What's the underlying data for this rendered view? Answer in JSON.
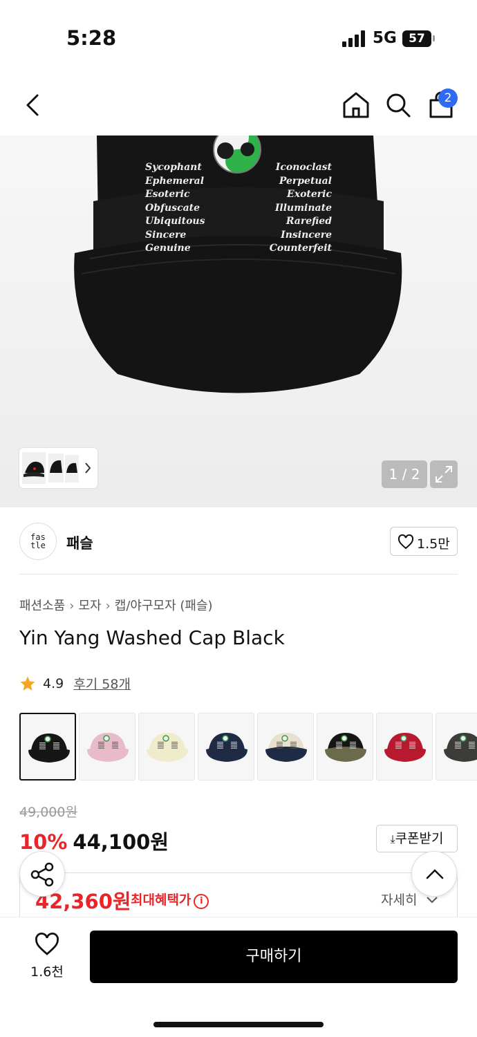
{
  "status_bar": {
    "time": "5:28",
    "network": "5G",
    "battery": "57"
  },
  "nav": {
    "cart_count": "2"
  },
  "gallery": {
    "counter": "1 / 2",
    "embroidery_left": [
      "Sycophant",
      "Ephemeral",
      "Esoteric",
      "Obfuscate",
      "Ubiquitous",
      "Sincere",
      "Genuine"
    ],
    "embroidery_right": [
      "Iconoclast",
      "Perpetual",
      "Exoteric",
      "Illuminate",
      "Rarefied",
      "Insincere",
      "Counterfeit"
    ]
  },
  "brand": {
    "logo_text_1": "fas",
    "logo_text_2": "tle",
    "name": "패슬",
    "like_count": "1.5만"
  },
  "breadcrumb": [
    "패션소품",
    "모자",
    "캡/야구모자 (패슬)"
  ],
  "product": {
    "title": "Yin Yang Washed Cap Black",
    "rating": "4.9",
    "reviews": "후기 58개"
  },
  "swatches": [
    {
      "name": "black",
      "color": "#161616",
      "brim": "#161616"
    },
    {
      "name": "pink",
      "color": "#e7bcc8",
      "brim": "#e7bcc8"
    },
    {
      "name": "cream",
      "color": "#efeccb",
      "brim": "#efeccb"
    },
    {
      "name": "navy",
      "color": "#1f2a44",
      "brim": "#1f2a44"
    },
    {
      "name": "beige-navy",
      "color": "#e9dfce",
      "brim": "#1f2a44"
    },
    {
      "name": "black-camo",
      "color": "#161616",
      "brim": "#6b6a4a"
    },
    {
      "name": "red",
      "color": "#b8192e",
      "brim": "#b8192e"
    },
    {
      "name": "charcoal",
      "color": "#3c3d38",
      "brim": "#3c3d38"
    }
  ],
  "pricing": {
    "original": "49,000원",
    "discount": "10%",
    "sale": "44,100원",
    "coupon_label": "쿠폰받기",
    "max_benefit_price": "42,360원",
    "max_benefit_label": "최대혜택가",
    "details_label": "자세히"
  },
  "bottom": {
    "wish_count": "1.6천",
    "buy_label": "구매하기"
  },
  "colors": {
    "accent_red": "#e8262a",
    "badge_blue": "#2f6bf2"
  }
}
